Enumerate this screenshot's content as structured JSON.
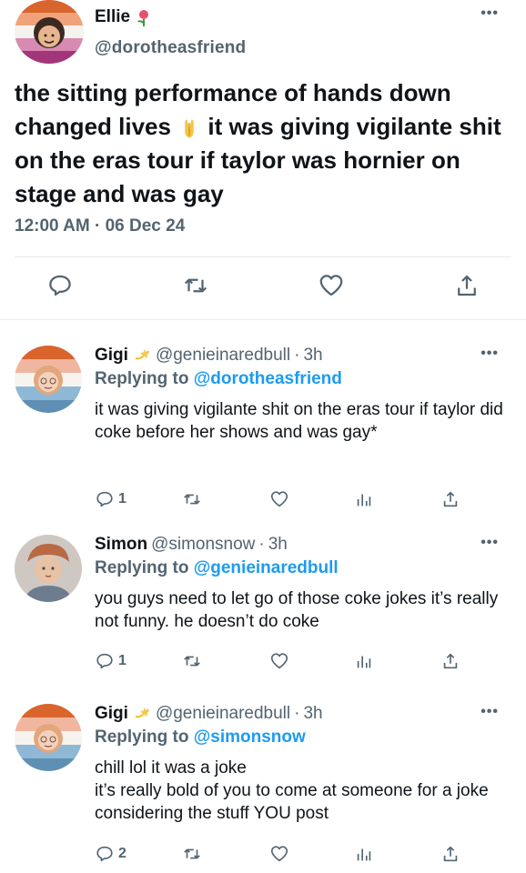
{
  "main_tweet": {
    "author_name": "Ellie",
    "author_name_emoji": "rose-emoji",
    "handle": "@dorotheasfriend",
    "text_part1": "the sitting performance of hands down changed lives",
    "text_emoji": "folded-hands-emoji",
    "text_part2": " it was giving vigilante shit on the eras tour if taylor was hornier on stage and was gay",
    "timestamp": "12:00 AM · 06 Dec 24",
    "more_label": "•••",
    "actions": [
      "reply-icon",
      "retweet-icon",
      "like-icon",
      "share-icon"
    ]
  },
  "replies": [
    {
      "author_name": "Gigi",
      "author_emoji": "dizzy-emoji",
      "handle": "@genieinaredbull",
      "dot": "·",
      "time": "3h",
      "replying_prefix": "Replying to ",
      "replying_to": "@dorotheasfriend",
      "text": "it was giving vigilante shit on the eras tour if taylor did coke before her shows and was gay*",
      "reply_count": "1",
      "more_label": "•••"
    },
    {
      "author_name": "Simon",
      "author_emoji": "",
      "handle": "@simonsnow",
      "dot": "·",
      "time": "3h",
      "replying_prefix": "Replying to ",
      "replying_to": "@genieinaredbull",
      "text": "you guys need to let go of those coke jokes it’s really not funny. he doesn’t do coke",
      "reply_count": "1",
      "more_label": "•••"
    },
    {
      "author_name": "Gigi",
      "author_emoji": "dizzy-emoji",
      "handle": "@genieinaredbull",
      "dot": "·",
      "time": "3h",
      "replying_prefix": "Replying to ",
      "replying_to": "@simonsnow",
      "text": "chill lol it was a joke\nit’s really bold of you to come at someone for a joke considering the stuff YOU post",
      "reply_count": "2",
      "more_label": "•••"
    }
  ],
  "colors": {
    "link": "#1d9bf0",
    "secondary_text": "#536471",
    "divider": "#e6ecf0"
  }
}
